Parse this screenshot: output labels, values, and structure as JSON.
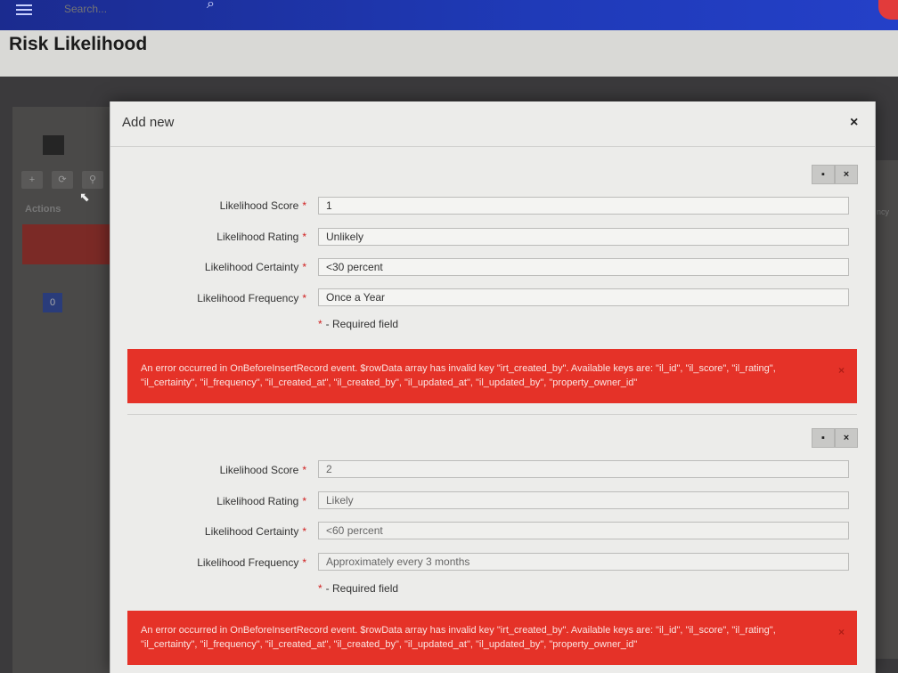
{
  "topbar": {
    "search_placeholder": "Search..."
  },
  "page": {
    "title": "Risk Likelihood"
  },
  "background": {
    "actions_label": "Actions",
    "pager_current": "0",
    "context_text": "ncy"
  },
  "modal": {
    "title": "Add new",
    "close_glyph": "×",
    "records": [
      {
        "copy_glyph": "▪",
        "remove_glyph": "×",
        "fields": [
          {
            "label": "Likelihood Score",
            "value": "1"
          },
          {
            "label": "Likelihood Rating",
            "value": "Unlikely"
          },
          {
            "label": "Likelihood Certainty",
            "value": "<30 percent"
          },
          {
            "label": "Likelihood Frequency",
            "value": "Once a Year"
          }
        ],
        "required_note": "- Required field",
        "error": "An error occurred in OnBeforeInsertRecord event. $rowData array has invalid key \"irt_created_by\". Available keys are: \"il_id\", \"il_score\", \"il_rating\", \"il_certainty\", \"il_frequency\", \"il_created_at\", \"il_created_by\", \"il_updated_at\", \"il_updated_by\", \"property_owner_id\"",
        "error_close": "×"
      },
      {
        "copy_glyph": "▪",
        "remove_glyph": "×",
        "fields": [
          {
            "label": "Likelihood Score",
            "value": "2"
          },
          {
            "label": "Likelihood Rating",
            "value": "Likely"
          },
          {
            "label": "Likelihood Certainty",
            "value": "<60 percent"
          },
          {
            "label": "Likelihood Frequency",
            "value": "Approximately every 3 months"
          }
        ],
        "required_note": "- Required field",
        "error": "An error occurred in OnBeforeInsertRecord event. $rowData array has invalid key \"irt_created_by\". Available keys are: \"il_id\", \"il_score\", \"il_rating\", \"il_certainty\", \"il_frequency\", \"il_created_at\", \"il_created_by\", \"il_updated_at\", \"il_updated_by\", \"property_owner_id\"",
        "error_close": "×"
      }
    ],
    "required_star": "*"
  },
  "colors": {
    "navbar": "#1f3ab8",
    "error_bg": "#e53228",
    "required": "#d02020"
  }
}
